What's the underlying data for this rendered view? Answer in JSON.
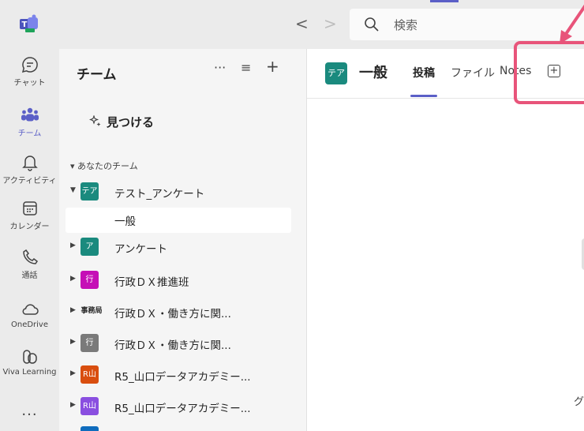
{
  "colors": {
    "accent": "#5b5fc7",
    "highlight": "#e8547a"
  },
  "topbar": {
    "search_placeholder": "検索",
    "back_label": "<",
    "forward_label": ">"
  },
  "rail": {
    "items": [
      {
        "label": "チャット",
        "icon": "chat-icon"
      },
      {
        "label": "チーム",
        "icon": "teams-icon"
      },
      {
        "label": "アクティビティ",
        "icon": "bell-icon"
      },
      {
        "label": "カレンダー",
        "icon": "calendar-icon"
      },
      {
        "label": "通話",
        "icon": "phone-icon"
      },
      {
        "label": "OneDrive",
        "icon": "cloud-icon"
      },
      {
        "label": "Viva Learning",
        "icon": "learning-icon"
      }
    ],
    "more_label": "..."
  },
  "panel": {
    "title": "チーム",
    "more_label": "···",
    "filter_label": "≡",
    "add_label": "+",
    "find_label": "見つける",
    "section_label": "▾ あなたのチーム",
    "teams": [
      {
        "avatar": "テア",
        "name": "テスト_アンケート",
        "color": "#1a8a7e",
        "expanded": true
      },
      {
        "avatar": "",
        "name": "一般",
        "channel": true
      },
      {
        "avatar": "ア",
        "name": "アンケート",
        "color": "#1a8a7e"
      },
      {
        "avatar": "行",
        "name": "行政ＤＸ推進班",
        "color": "#c50fb6"
      },
      {
        "avatar": "事務局",
        "name": "行政ＤＸ・働き方に関...",
        "color": "#ffffff"
      },
      {
        "avatar": "行",
        "name": "行政ＤＸ・働き方に関...",
        "color": "#7a7a7a"
      },
      {
        "avatar": "R山",
        "name": "R5_山口データアカデミー...",
        "color": "#d94e0f"
      },
      {
        "avatar": "R山",
        "name": "R5_山口データアカデミー...",
        "color": "#8a4fe0"
      }
    ]
  },
  "main": {
    "channel_avatar": "テア",
    "channel_name": "一般",
    "tabs": [
      "投稿",
      "ファイル",
      "Notes"
    ],
    "add_tab_label": "+",
    "bottom_text": "グ"
  }
}
